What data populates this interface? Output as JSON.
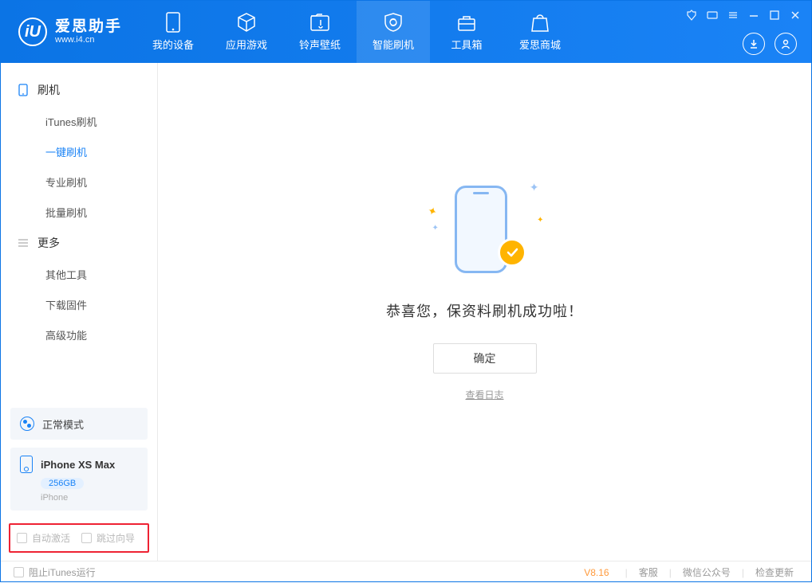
{
  "app": {
    "title": "爱思助手",
    "subtitle": "www.i4.cn"
  },
  "nav": {
    "items": [
      {
        "label": "我的设备"
      },
      {
        "label": "应用游戏"
      },
      {
        "label": "铃声壁纸"
      },
      {
        "label": "智能刷机"
      },
      {
        "label": "工具箱"
      },
      {
        "label": "爱思商城"
      }
    ]
  },
  "sidebar": {
    "groups": [
      {
        "title": "刷机",
        "items": [
          "iTunes刷机",
          "一键刷机",
          "专业刷机",
          "批量刷机"
        ]
      },
      {
        "title": "更多",
        "items": [
          "其他工具",
          "下载固件",
          "高级功能"
        ]
      }
    ],
    "status": "正常模式",
    "device": {
      "name": "iPhone XS Max",
      "storage": "256GB",
      "type": "iPhone"
    },
    "checks": {
      "auto_activate": "自动激活",
      "skip_guide": "跳过向导"
    }
  },
  "main": {
    "message": "恭喜您，保资料刷机成功啦！",
    "ok": "确定",
    "view_log": "查看日志"
  },
  "footer": {
    "block_itunes": "阻止iTunes运行",
    "version": "V8.16",
    "links": [
      "客服",
      "微信公众号",
      "检查更新"
    ]
  }
}
